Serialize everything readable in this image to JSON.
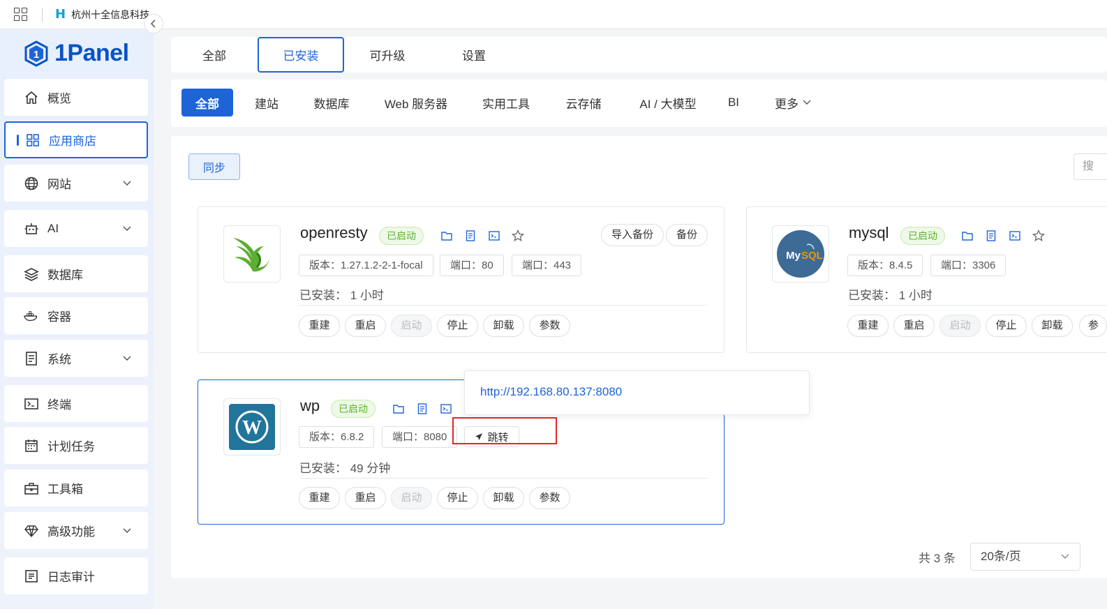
{
  "browser": {
    "site_title": "杭州十全信息科技..."
  },
  "brand": {
    "name": "1Panel"
  },
  "sidebar": {
    "items": [
      {
        "label": "概览",
        "icon": "home-icon"
      },
      {
        "label": "应用商店",
        "icon": "grid-icon",
        "active": true
      },
      {
        "label": "网站",
        "icon": "globe-icon",
        "expandable": true
      },
      {
        "label": "AI",
        "icon": "robot-icon",
        "expandable": true
      },
      {
        "label": "数据库",
        "icon": "layers-icon"
      },
      {
        "label": "容器",
        "icon": "docker-icon"
      },
      {
        "label": "系统",
        "icon": "server-icon",
        "expandable": true
      },
      {
        "label": "终端",
        "icon": "terminal-icon"
      },
      {
        "label": "计划任务",
        "icon": "calendar-icon"
      },
      {
        "label": "工具箱",
        "icon": "toolbox-icon"
      },
      {
        "label": "高级功能",
        "icon": "diamond-icon",
        "expandable": true
      },
      {
        "label": "日志审计",
        "icon": "log-icon"
      }
    ]
  },
  "tabs": [
    "全部",
    "已安装",
    "可升级",
    "设置"
  ],
  "filters": [
    "全部",
    "建站",
    "数据库",
    "Web 服务器",
    "实用工具",
    "云存储",
    "AI / 大模型",
    "BI",
    "更多"
  ],
  "toolbar": {
    "sync_label": "同步",
    "search_placeholder": "搜"
  },
  "apps": [
    {
      "name": "openresty",
      "status": "已启动",
      "version": "版本：1.27.1.2-2-1-focal",
      "ports": [
        "端口：80",
        "端口：443"
      ],
      "installed": "已安装：  1 小时",
      "top_buttons": [
        "导入备份",
        "备份"
      ],
      "actions": [
        "重建",
        "重启",
        "启动",
        "停止",
        "卸载",
        "参数"
      ]
    },
    {
      "name": "mysql",
      "status": "已启动",
      "version": "版本：8.4.5",
      "ports": [
        "端口：3306"
      ],
      "installed": "已安装：  1 小时",
      "actions": [
        "重建",
        "重启",
        "启动",
        "停止",
        "卸载",
        "参"
      ]
    },
    {
      "name": "wp",
      "status": "已启动",
      "version": "版本：6.8.2",
      "ports": [
        "端口：8080"
      ],
      "jump_label": "跳转",
      "installed": "已安装：  49 分钟",
      "actions": [
        "重建",
        "重启",
        "启动",
        "停止",
        "卸载",
        "参数"
      ]
    }
  ],
  "popover": {
    "url": "http://192.168.80.137:8080"
  },
  "pagination": {
    "total": "共 3 条",
    "page_size": "20条/页"
  },
  "colors": {
    "primary": "#1e64d8",
    "success": "#59b427",
    "highlight": "#e0262c"
  }
}
